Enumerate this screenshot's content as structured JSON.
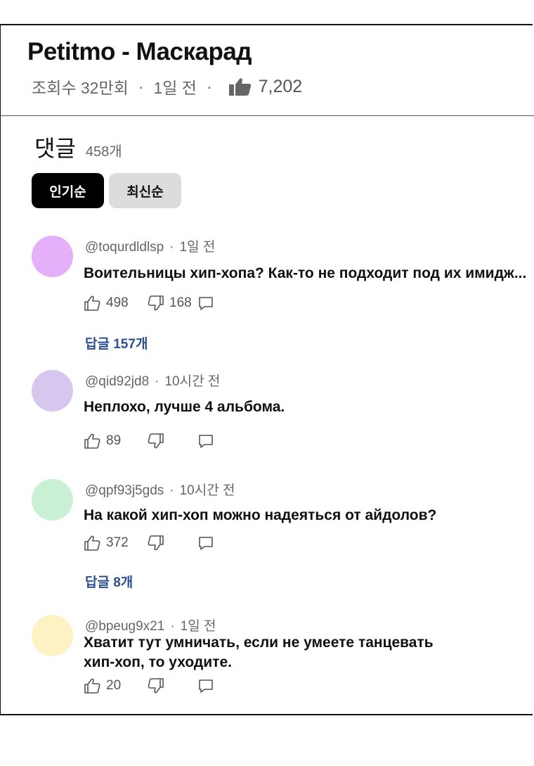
{
  "video": {
    "title": "Petitmo - Маскарад",
    "views": "조회수 32만회",
    "dot1": "·",
    "age": "1일 전",
    "dot2": "·",
    "likes": "7,202"
  },
  "comments_header": {
    "title": "댓글",
    "count": "458개"
  },
  "sort": {
    "popular_label": "인기순",
    "latest_label": "최신순"
  },
  "comments": [
    {
      "avatar_color": "#e3b0f9",
      "author": "@toqurdldlsp",
      "separator": "·",
      "time": "1일 전",
      "text": "Воительницы хип-хопа? Как-то не подходит под их имидж...",
      "likes": "498",
      "dislikes": "168",
      "replies": "답글 157개"
    },
    {
      "avatar_color": "#d7c6ee",
      "author": "@qid92jd8",
      "separator": "·",
      "time": "10시간 전",
      "text": "Неплохо, лучше 4 альбома.",
      "likes": "89",
      "dislikes": ""
    },
    {
      "avatar_color": "#c9efd4",
      "author": "@qpf93j5gds",
      "separator": "·",
      "time": "10시간 전",
      "text": "На какой хип-хоп можно надеяться от айдолов?",
      "likes": "372",
      "dislikes": "",
      "replies": "답글 8개"
    },
    {
      "avatar_color": "#fdf2c4",
      "author": "@bpeug9x21",
      "separator": "·",
      "time": "1일 전",
      "text_line1": "Хватит тут умничать, если не умеете танцевать",
      "text_line2": "хип-хоп, то уходите.",
      "likes": "20",
      "dislikes": ""
    }
  ],
  "icons": {
    "like": "thumbs-up-icon",
    "dislike": "thumbs-down-icon",
    "reply": "reply-icon"
  },
  "colors": {
    "reply_link": "#2c4f8f",
    "sort_active_bg": "#000000",
    "sort_inactive_bg": "#dcdcdc"
  }
}
